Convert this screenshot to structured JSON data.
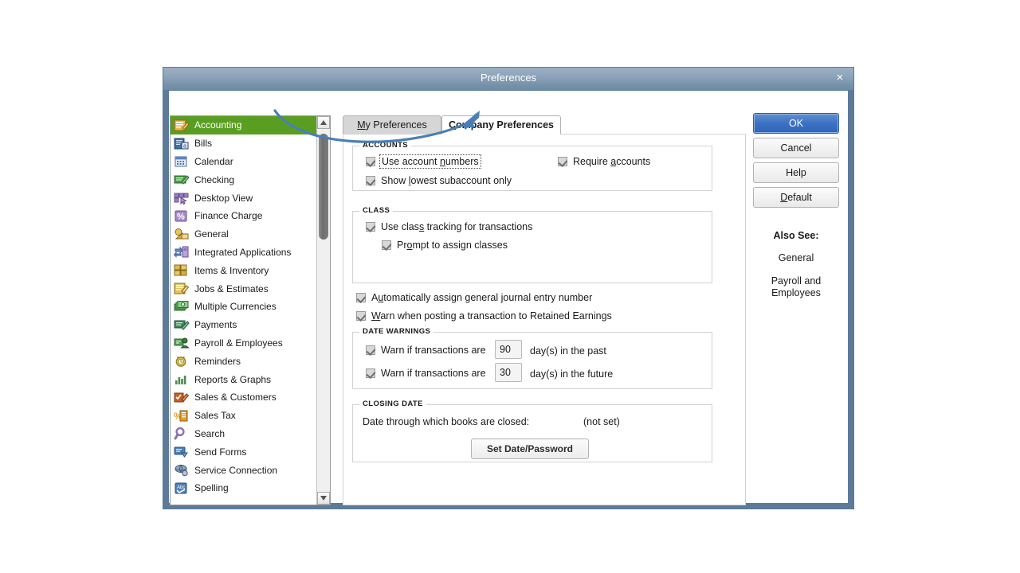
{
  "window": {
    "title": "Preferences",
    "close_label": "×"
  },
  "sidebar": {
    "items": [
      {
        "label": "Accounting",
        "icon": "accounting-icon",
        "selected": true
      },
      {
        "label": "Bills",
        "icon": "bills-icon",
        "selected": false
      },
      {
        "label": "Calendar",
        "icon": "calendar-icon",
        "selected": false
      },
      {
        "label": "Checking",
        "icon": "checking-icon",
        "selected": false
      },
      {
        "label": "Desktop View",
        "icon": "desktop-view-icon",
        "selected": false
      },
      {
        "label": "Finance Charge",
        "icon": "finance-charge-icon",
        "selected": false
      },
      {
        "label": "General",
        "icon": "general-icon",
        "selected": false
      },
      {
        "label": "Integrated Applications",
        "icon": "integrated-applications-icon",
        "selected": false
      },
      {
        "label": "Items & Inventory",
        "icon": "items-inventory-icon",
        "selected": false
      },
      {
        "label": "Jobs & Estimates",
        "icon": "jobs-estimates-icon",
        "selected": false
      },
      {
        "label": "Multiple Currencies",
        "icon": "multiple-currencies-icon",
        "selected": false
      },
      {
        "label": "Payments",
        "icon": "payments-icon",
        "selected": false
      },
      {
        "label": "Payroll & Employees",
        "icon": "payroll-employees-icon",
        "selected": false
      },
      {
        "label": "Reminders",
        "icon": "reminders-icon",
        "selected": false
      },
      {
        "label": "Reports & Graphs",
        "icon": "reports-graphs-icon",
        "selected": false
      },
      {
        "label": "Sales & Customers",
        "icon": "sales-customers-icon",
        "selected": false
      },
      {
        "label": "Sales Tax",
        "icon": "sales-tax-icon",
        "selected": false
      },
      {
        "label": "Search",
        "icon": "search-icon",
        "selected": false
      },
      {
        "label": "Send Forms",
        "icon": "send-forms-icon",
        "selected": false
      },
      {
        "label": "Service Connection",
        "icon": "service-connection-icon",
        "selected": false
      },
      {
        "label": "Spelling",
        "icon": "spelling-icon",
        "selected": false
      }
    ]
  },
  "tabs": {
    "my_preferences": "My Preferences",
    "my_preferences_mnemonic": "M",
    "my_preferences_rest": "y Preferences",
    "company_preferences": "Company Preferences",
    "company_preferences_mnemonic": "C",
    "company_preferences_rest": "ompany Preferences",
    "active": "Company Preferences"
  },
  "sections": {
    "accounts": {
      "title": "ACCOUNTS",
      "use_account_numbers": {
        "label_pre": "Use account ",
        "label_mnemonic": "n",
        "label_post": "umbers",
        "checked": true,
        "focused": true
      },
      "require_accounts": {
        "label_pre": "Require ",
        "label_mnemonic": "a",
        "label_post": "ccounts",
        "checked": true
      },
      "show_lowest_subaccount": {
        "label_pre": "Show ",
        "label_mnemonic": "l",
        "label_post": "owest subaccount only",
        "checked": true
      }
    },
    "class": {
      "title": "CLASS",
      "use_class_tracking": {
        "label_pre": "Use clas",
        "label_mnemonic": "s",
        "label_post": " tracking for transactions",
        "checked": true
      },
      "prompt_assign_classes": {
        "label_pre": "Pr",
        "label_mnemonic": "o",
        "label_post": "mpt to assign classes",
        "checked": true
      }
    },
    "standalone": {
      "auto_assign_journal": {
        "label_pre": "A",
        "label_mnemonic": "u",
        "label_post": "tomatically assign general journal entry number",
        "checked": true
      },
      "warn_retained_earnings": {
        "label_pre": "",
        "label_mnemonic": "W",
        "label_post": "arn when posting a transaction to Retained Earnings",
        "checked": true
      }
    },
    "date_warnings": {
      "title": "DATE WARNINGS",
      "past": {
        "label": "Warn if transactions are",
        "value": "90",
        "suffix": "day(s) in the past",
        "checked": true
      },
      "future": {
        "label": "Warn if transactions are",
        "value": "30",
        "suffix": "day(s) in the future",
        "checked": true
      }
    },
    "closing_date": {
      "title": "CLOSING DATE",
      "label": "Date through which books are closed:",
      "value": "(not set)",
      "button": "Set Date/Password"
    }
  },
  "buttons": {
    "ok": "OK",
    "cancel": "Cancel",
    "help": "Help",
    "default_mnemonic": "D",
    "default_rest": "efault"
  },
  "also_see": {
    "heading": "Also See:",
    "links": [
      "General",
      "Payroll and Employees"
    ]
  },
  "colors": {
    "selection_green": "#5a9e21",
    "titlebar_blue": "#7693ab",
    "window_border": "#5c7b99",
    "primary_button": "#3d72c2",
    "annotation_arrow": "#4a7fb5"
  }
}
